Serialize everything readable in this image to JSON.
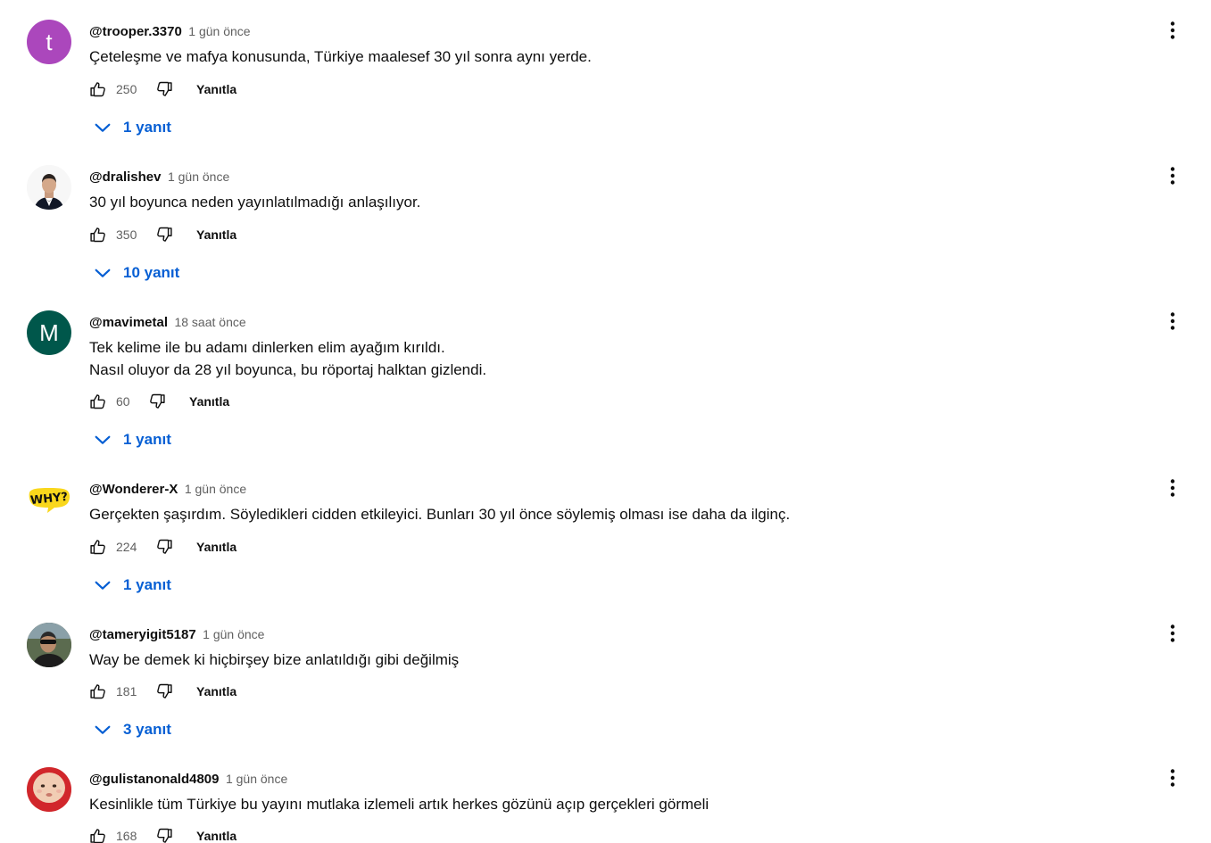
{
  "colors": {
    "link_blue": "#065fd4",
    "secondary_text": "#606060",
    "primary_text": "#0f0f0f"
  },
  "icons": {
    "like": "thumb-up-outline-icon",
    "dislike": "thumb-down-outline-icon",
    "replies_toggle": "chevron-down-icon",
    "menu": "more-vertical-icon"
  },
  "comments": [
    {
      "author": "@trooper.3370",
      "time": "1 gün önce",
      "avatar": {
        "type": "letter",
        "letter": "t",
        "color": "#ab47bc"
      },
      "text": [
        "Çeteleşme ve mafya konusunda, Türkiye maalesef 30 yıl sonra aynı yerde."
      ],
      "likes": "250",
      "reply_label": "Yanıtla",
      "replies": "1 yanıt"
    },
    {
      "author": "@dralishev",
      "time": "1 gün önce",
      "avatar": {
        "type": "photo",
        "description": "man-in-tuxedo"
      },
      "text": [
        "30 yıl boyunca neden yayınlatılmadığı anlaşılıyor."
      ],
      "likes": "350",
      "reply_label": "Yanıtla",
      "replies": "10 yanıt"
    },
    {
      "author": "@mavimetal",
      "time": "18 saat önce",
      "avatar": {
        "type": "letter",
        "letter": "M",
        "color": "#00574b"
      },
      "text": [
        "Tek kelime ile bu adamı dinlerken elim ayağım kırıldı.",
        "Nasıl oluyor da 28 yıl boyunca, bu röportaj halktan gizlendi."
      ],
      "likes": "60",
      "reply_label": "Yanıtla",
      "replies": "1 yanıt"
    },
    {
      "author": "@Wonderer-X",
      "time": "1 gün önce",
      "avatar": {
        "type": "logo",
        "logo_text": "WHY?",
        "color": "#f9d71c"
      },
      "text": [
        "Gerçekten şaşırdım. Söyledikleri cidden etkileyici. Bunları 30 yıl önce söylemiş olması ise daha da ilginç."
      ],
      "likes": "224",
      "reply_label": "Yanıtla",
      "replies": "1 yanıt"
    },
    {
      "author": "@tameryigit5187",
      "time": "1 gün önce",
      "avatar": {
        "type": "photo",
        "description": "man-with-sunglasses"
      },
      "text": [
        "Way be demek ki hiçbirşey bize anlatıldığı gibi değilmiş"
      ],
      "likes": "181",
      "reply_label": "Yanıtla",
      "replies": "3 yanıt"
    },
    {
      "author": "@gulistanonald4809",
      "time": "1 gün önce",
      "avatar": {
        "type": "photo",
        "description": "baby-face"
      },
      "text": [
        "Kesinlikle tüm Türkiye bu yayını mutlaka izlemeli artık herkes gözünü açıp gerçekleri görmeli"
      ],
      "likes": "168",
      "reply_label": "Yanıtla",
      "replies": ""
    }
  ]
}
